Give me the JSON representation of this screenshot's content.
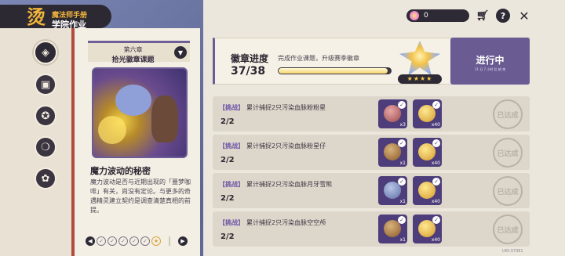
{
  "header": {
    "title_small": "魔法师手册",
    "title_main": "学院作业",
    "glyph": "烫"
  },
  "nav": {
    "items": [
      "chapter-book",
      "gift",
      "star-badge",
      "bubble",
      "clover-medal"
    ]
  },
  "chapter": {
    "number": "第六章",
    "name": "拾光徽章课题",
    "story_title": "魔力波动的秘密",
    "story_body": "魔力波动是否与近期出现的「噩梦咖啡」有关，尚没有定论。与更多的奇遇精灵建立契约是调查清楚真相的前提。",
    "pager": {
      "total": 6,
      "completed": 5
    }
  },
  "topbar": {
    "currency_value": "0",
    "shop_icon": "cart-icon",
    "help_icon": "help-icon",
    "close_icon": "close-icon"
  },
  "banner": {
    "title": "徽章进度",
    "subtitle": "完成作业课题，升级赛季徽章",
    "count": "37/38",
    "progress": 0.974,
    "stars": "★★★★",
    "status": "进行中",
    "status_sub": "11 日 7 小时 后 结 束"
  },
  "tasks": [
    {
      "tag": "【挑战】",
      "text": "累计捕捉2只污染血脉粉粉星",
      "count": "2/2",
      "reward1_qty": "x3",
      "reward2_qty": "x40",
      "stamp": "已达成"
    },
    {
      "tag": "【挑战】",
      "text": "累计捕捉2只污染血脉粉星仔",
      "count": "2/2",
      "reward1_qty": "x1",
      "reward2_qty": "x40",
      "stamp": "已达成"
    },
    {
      "tag": "【挑战】",
      "text": "累计捕捉2只污染血脉月牙雪熊",
      "count": "2/2",
      "reward1_qty": "x1",
      "reward2_qty": "x40",
      "stamp": "已达成"
    },
    {
      "tag": "【挑战】",
      "text": "累计捕捉2只污染血脉空空颅",
      "count": "2/2",
      "reward1_qty": "x1",
      "reward2_qty": "x40",
      "stamp": "已达成"
    }
  ],
  "footer": {
    "uid": "UID:37361"
  },
  "colors": {
    "accent": "#6a5b92",
    "gold": "#f2b53b",
    "dark": "#2e2a35"
  }
}
